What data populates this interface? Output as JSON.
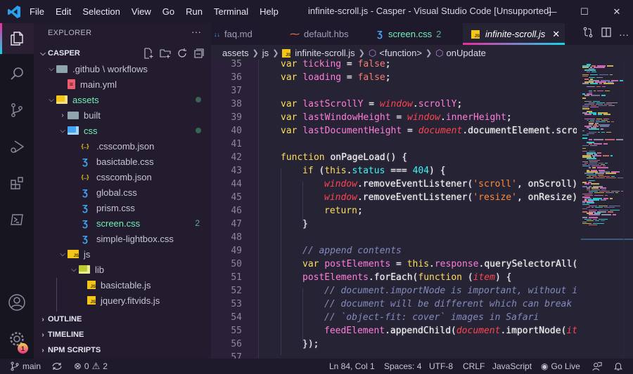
{
  "titlebar": {
    "menu": [
      "File",
      "Edit",
      "Selection",
      "View",
      "Go",
      "Run",
      "Terminal",
      "Help"
    ],
    "title": "infinite-scroll.js - Casper - Visual Studio Code [Unsupported]",
    "minimize": "—",
    "maximize": "☐",
    "close": "✕"
  },
  "activity_bar": {
    "items": [
      "explorer-icon",
      "search-icon",
      "source-control-icon",
      "run-debug-icon",
      "extensions-icon",
      "remote-explorer-icon"
    ],
    "bottom": [
      "account-icon",
      "manage-gear-icon"
    ],
    "settings_badge": "1"
  },
  "sidebar": {
    "header": "EXPLORER",
    "more": "···",
    "root": "CASPER",
    "tree": [
      {
        "name": ".github \\ workflows",
        "type": "folder",
        "open": true,
        "depth": 1
      },
      {
        "name": "main.yml",
        "type": "yml",
        "depth": 2
      },
      {
        "name": "assets",
        "type": "folder-assets",
        "open": true,
        "depth": 1,
        "modified": true
      },
      {
        "name": "built",
        "type": "folder",
        "open": false,
        "depth": 2
      },
      {
        "name": "css",
        "type": "folder-css",
        "open": true,
        "depth": 2,
        "modified": true
      },
      {
        "name": ".csscomb.json",
        "type": "json",
        "depth": 3
      },
      {
        "name": "basictable.css",
        "type": "css",
        "depth": 3
      },
      {
        "name": "csscomb.json",
        "type": "json",
        "depth": 3
      },
      {
        "name": "global.css",
        "type": "css",
        "depth": 3
      },
      {
        "name": "prism.css",
        "type": "css",
        "depth": 3
      },
      {
        "name": "screen.css",
        "type": "css",
        "depth": 3,
        "modified": true,
        "count": "2"
      },
      {
        "name": "simple-lightbox.css",
        "type": "css",
        "depth": 3
      },
      {
        "name": "js",
        "type": "folder-js",
        "open": true,
        "depth": 2
      },
      {
        "name": "lib",
        "type": "folder-lib",
        "open": true,
        "depth": 3
      },
      {
        "name": "basictable.js",
        "type": "js",
        "depth": 4
      },
      {
        "name": "jquery.fitvids.js",
        "type": "js",
        "depth": 4
      }
    ],
    "sections": [
      "OUTLINE",
      "TIMELINE",
      "NPM SCRIPTS"
    ]
  },
  "tabs": [
    {
      "label": "faq.md",
      "icon": "markdown-icon",
      "active": false
    },
    {
      "label": "default.hbs",
      "icon": "handlebars-icon",
      "active": false
    },
    {
      "label": "screen.css",
      "icon": "css-icon",
      "active": false,
      "badge": "2"
    },
    {
      "label": "infinite-scroll.js",
      "icon": "js-icon",
      "active": true,
      "close": "✕"
    }
  ],
  "breadcrumb": [
    "assets",
    "js",
    "infinite-scroll.js",
    "<function>",
    "onUpdate"
  ],
  "editor": {
    "line_numbers": [
      "35",
      "36",
      "37",
      "38",
      "39",
      "40",
      "41",
      "42",
      "43",
      "44",
      "45",
      "46",
      "47",
      "48",
      "49",
      "50",
      "51",
      "52",
      "53",
      "54",
      "55",
      "56",
      "57"
    ],
    "lines": [
      {
        "indent": 0,
        "tokens": [
          [
            "kw",
            "var "
          ],
          [
            "var",
            "ticking"
          ],
          [
            "wh",
            " = "
          ],
          [
            "bool",
            "false"
          ],
          [
            "wh",
            ";"
          ]
        ]
      },
      {
        "indent": 0,
        "tokens": [
          [
            "kw",
            "var "
          ],
          [
            "var",
            "loading"
          ],
          [
            "wh",
            " = "
          ],
          [
            "bool",
            "false"
          ],
          [
            "wh",
            ";"
          ]
        ]
      },
      {
        "indent": 0,
        "tokens": []
      },
      {
        "indent": 0,
        "tokens": [
          [
            "kw",
            "var "
          ],
          [
            "var",
            "lastScrollY"
          ],
          [
            "wh",
            " = "
          ],
          [
            "glob",
            "window"
          ],
          [
            "wh",
            "."
          ],
          [
            "var",
            "scrollY"
          ],
          [
            "wh",
            ";"
          ]
        ]
      },
      {
        "indent": 0,
        "tokens": [
          [
            "kw",
            "var "
          ],
          [
            "var",
            "lastWindowHeight"
          ],
          [
            "wh",
            " = "
          ],
          [
            "glob",
            "window"
          ],
          [
            "wh",
            "."
          ],
          [
            "var",
            "innerHeight"
          ],
          [
            "wh",
            ";"
          ]
        ]
      },
      {
        "indent": 0,
        "tokens": [
          [
            "kw",
            "var "
          ],
          [
            "var",
            "lastDocumentHeight"
          ],
          [
            "wh",
            " = "
          ],
          [
            "glob",
            "document"
          ],
          [
            "wh",
            "."
          ],
          [
            "wh",
            "documentElement"
          ],
          [
            "wh",
            "."
          ],
          [
            "wh",
            "scrol"
          ]
        ]
      },
      {
        "indent": 0,
        "tokens": []
      },
      {
        "indent": 0,
        "tokens": [
          [
            "kw",
            "function "
          ],
          [
            "wh",
            "onPageLoad"
          ],
          [
            "wh",
            "() {"
          ]
        ]
      },
      {
        "indent": 1,
        "tokens": [
          [
            "kw",
            "if "
          ],
          [
            "wh",
            "("
          ],
          [
            "kw",
            "this"
          ],
          [
            "wh",
            "."
          ],
          [
            "prop",
            "status"
          ],
          [
            "wh",
            " === "
          ],
          [
            "prop",
            "404"
          ],
          [
            "wh",
            ") {"
          ]
        ]
      },
      {
        "indent": 2,
        "tokens": [
          [
            "glob",
            "window"
          ],
          [
            "wh",
            "."
          ],
          [
            "wh",
            "removeEventListener"
          ],
          [
            "wh",
            "("
          ],
          [
            "str",
            "'scroll'"
          ],
          [
            "wh",
            ", onScroll);"
          ]
        ]
      },
      {
        "indent": 2,
        "tokens": [
          [
            "glob",
            "window"
          ],
          [
            "wh",
            "."
          ],
          [
            "wh",
            "removeEventListener"
          ],
          [
            "wh",
            "("
          ],
          [
            "str",
            "'resize'"
          ],
          [
            "wh",
            ", onResize);"
          ]
        ]
      },
      {
        "indent": 2,
        "tokens": [
          [
            "kw",
            "return"
          ],
          [
            "wh",
            ";"
          ]
        ]
      },
      {
        "indent": 1,
        "tokens": [
          [
            "wh",
            "}"
          ]
        ]
      },
      {
        "indent": 0,
        "tokens": []
      },
      {
        "indent": 1,
        "tokens": [
          [
            "cmt",
            "// append contents"
          ]
        ]
      },
      {
        "indent": 1,
        "tokens": [
          [
            "kw",
            "var "
          ],
          [
            "var",
            "postElements"
          ],
          [
            "wh",
            " = "
          ],
          [
            "kw",
            "this"
          ],
          [
            "wh",
            "."
          ],
          [
            "var",
            "response"
          ],
          [
            "wh",
            "."
          ],
          [
            "wh",
            "querySelectorAll("
          ],
          [
            "str",
            "'"
          ]
        ]
      },
      {
        "indent": 1,
        "tokens": [
          [
            "var",
            "postElements"
          ],
          [
            "wh",
            "."
          ],
          [
            "wh",
            "forEach("
          ],
          [
            "kw",
            "function "
          ],
          [
            "wh",
            "("
          ],
          [
            "glob",
            "item"
          ],
          [
            "wh",
            ") {"
          ]
        ]
      },
      {
        "indent": 2,
        "tokens": [
          [
            "cmt",
            "// document.importNode is important, without it"
          ]
        ]
      },
      {
        "indent": 2,
        "tokens": [
          [
            "cmt",
            "// document will be different which can break n"
          ]
        ]
      },
      {
        "indent": 2,
        "tokens": [
          [
            "cmt",
            "// `object-fit: cover` images in Safari"
          ]
        ]
      },
      {
        "indent": 2,
        "tokens": [
          [
            "var",
            "feedElement"
          ],
          [
            "wh",
            "."
          ],
          [
            "wh",
            "appendChild("
          ],
          [
            "glob",
            "document"
          ],
          [
            "wh",
            "."
          ],
          [
            "wh",
            "importNode("
          ],
          [
            "glob",
            "ite"
          ]
        ]
      },
      {
        "indent": 1,
        "tokens": [
          [
            "wh",
            "});"
          ]
        ]
      },
      {
        "indent": 0,
        "tokens": []
      }
    ]
  },
  "statusbar": {
    "branch": "main",
    "errors": "0",
    "warnings": "2",
    "position": "Ln 84, Col 1",
    "spaces": "Spaces: 4",
    "encoding": "UTF-8",
    "eol": "CRLF",
    "language": "JavaScript",
    "golive": "Go Live"
  },
  "colors": {
    "accent_pink": "#f02aa0",
    "accent_cyan": "#14d4ea",
    "modified_green": "#72f1b8",
    "keyword": "#fede5d",
    "variable": "#ff7edb",
    "string": "#ff8b39"
  }
}
